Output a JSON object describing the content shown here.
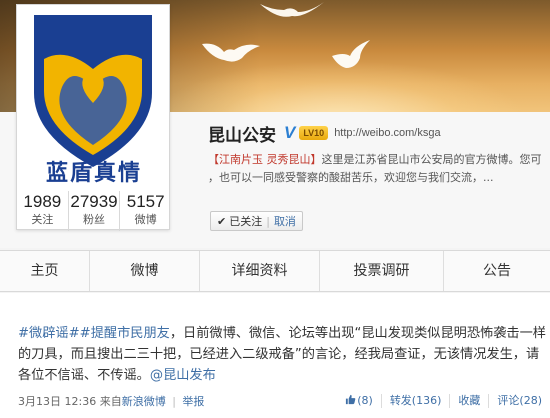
{
  "profile": {
    "logo_caption": "蓝盾真情",
    "name": "昆山公安",
    "verified_mark": "V",
    "level_badge": "LV10",
    "url": "http://weibo.com/ksga",
    "description_tag": "【江南片玉 灵秀昆山】",
    "description_text": "这里是江苏省昆山市公安局的官方微博。您可",
    "description_line2": "，也可以一同感受警察的酸甜苦乐，欢迎您与我们交流，...",
    "counts": [
      {
        "value": "1989",
        "label": "关注"
      },
      {
        "value": "27939",
        "label": "粉丝"
      },
      {
        "value": "5157",
        "label": "微博"
      }
    ],
    "follow_button": {
      "label": "已关注",
      "separator": "|",
      "cancel_label": "取消"
    }
  },
  "nav": {
    "tabs": [
      {
        "label": "主页"
      },
      {
        "label": "微博"
      },
      {
        "label": "详细资料"
      },
      {
        "label": "投票调研"
      },
      {
        "label": "公告"
      }
    ]
  },
  "post": {
    "hashtag_1": "#微辟谣#",
    "hashtag_2": "#提醒市民朋友",
    "body": "，日前微博、微信、论坛等出现“昆山发现类似昆明恐怖袭击一样的刀具，而且搜出二三十把，已经进入二级戒备”的言论，经我局查证，无该情况发生，请各位不信谣、不传谣。",
    "mention": "@昆山发布",
    "timestamp": "3月13日 12:36",
    "source_prefix": "来自",
    "source": "新浪微博",
    "meta_separator": "|",
    "report": "举报",
    "actions": {
      "like": "(8)",
      "repost": "转发(136)",
      "favorite": "收藏",
      "comment": "评论(28)"
    }
  },
  "colors": {
    "link": "#3f6fa6",
    "logo_blue": "#1a3f92",
    "logo_gold": "#f2b400",
    "verified": "#2c7fd2"
  }
}
